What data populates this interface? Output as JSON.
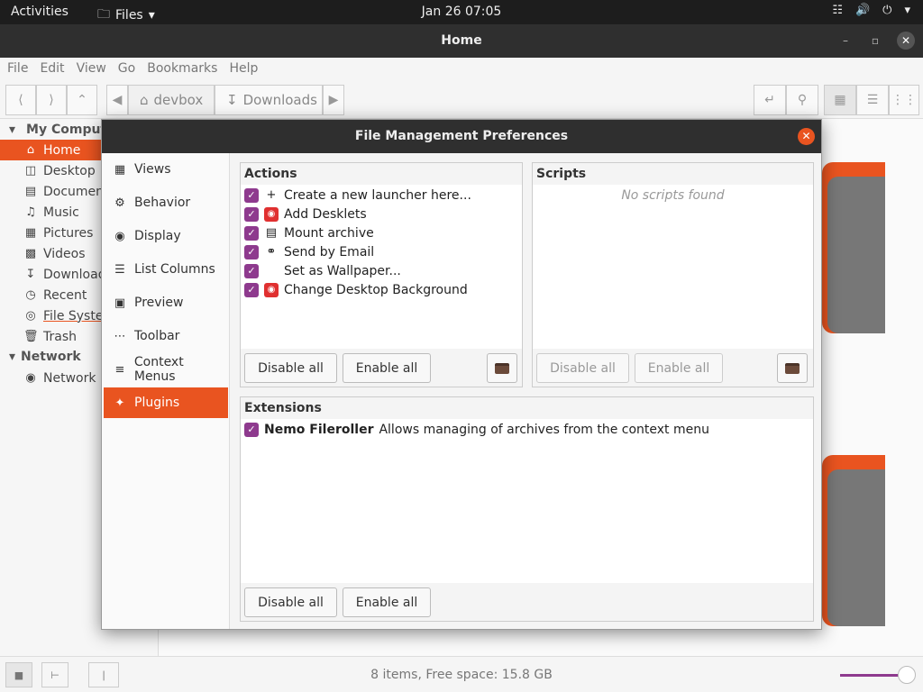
{
  "topbar": {
    "activities": "Activities",
    "app": "Files",
    "clock": "Jan 26  07:05"
  },
  "window": {
    "title": "Home"
  },
  "menubar": [
    "File",
    "Edit",
    "View",
    "Go",
    "Bookmarks",
    "Help"
  ],
  "breadcrumb": {
    "items": [
      "devbox",
      "Downloads"
    ]
  },
  "sidebar": {
    "sections": [
      {
        "title": "My Computer",
        "items": [
          {
            "label": "Home",
            "icon": "home-icon",
            "active": true
          },
          {
            "label": "Desktop",
            "icon": "desktop-icon"
          },
          {
            "label": "Documents",
            "icon": "documents-icon"
          },
          {
            "label": "Music",
            "icon": "music-icon"
          },
          {
            "label": "Pictures",
            "icon": "pictures-icon"
          },
          {
            "label": "Videos",
            "icon": "videos-icon"
          },
          {
            "label": "Downloads",
            "icon": "downloads-icon"
          },
          {
            "label": "Recent",
            "icon": "recent-icon"
          },
          {
            "label": "File System",
            "icon": "filesystem-icon"
          },
          {
            "label": "Trash",
            "icon": "trash-icon"
          }
        ]
      },
      {
        "title": "Network",
        "items": [
          {
            "label": "Network",
            "icon": "network-icon"
          }
        ]
      }
    ]
  },
  "statusbar": {
    "text": "8 items, Free space: 15.8 GB"
  },
  "dialog": {
    "title": "File Management Preferences",
    "nav": [
      {
        "label": "Views",
        "icon": "views-icon"
      },
      {
        "label": "Behavior",
        "icon": "gear-icon"
      },
      {
        "label": "Display",
        "icon": "eye-icon"
      },
      {
        "label": "List Columns",
        "icon": "list-icon"
      },
      {
        "label": "Preview",
        "icon": "image-icon"
      },
      {
        "label": "Toolbar",
        "icon": "dots-icon"
      },
      {
        "label": "Context Menus",
        "icon": "menu-icon"
      },
      {
        "label": "Plugins",
        "icon": "puzzle-icon",
        "active": true
      }
    ],
    "actions": {
      "title": "Actions",
      "items": [
        {
          "label": "Create a new launcher here...",
          "icon": "plus-icon",
          "checked": true
        },
        {
          "label": "Add Desklets",
          "icon": "desklet-icon",
          "checked": true
        },
        {
          "label": "Mount archive",
          "icon": "archive-icon",
          "checked": true
        },
        {
          "label": "Send by Email",
          "icon": "attach-icon",
          "checked": true
        },
        {
          "label": "Set as Wallpaper...",
          "icon": "",
          "checked": true
        },
        {
          "label": "Change Desktop Background",
          "icon": "desklet-icon",
          "checked": true
        }
      ],
      "disable_all": "Disable all",
      "enable_all": "Enable all"
    },
    "scripts": {
      "title": "Scripts",
      "empty": "No scripts found",
      "disable_all": "Disable all",
      "enable_all": "Enable all"
    },
    "extensions": {
      "title": "Extensions",
      "items": [
        {
          "name": "Nemo Fileroller",
          "description": "Allows managing of archives from the context menu",
          "checked": true
        }
      ],
      "disable_all": "Disable all",
      "enable_all": "Enable all"
    }
  }
}
